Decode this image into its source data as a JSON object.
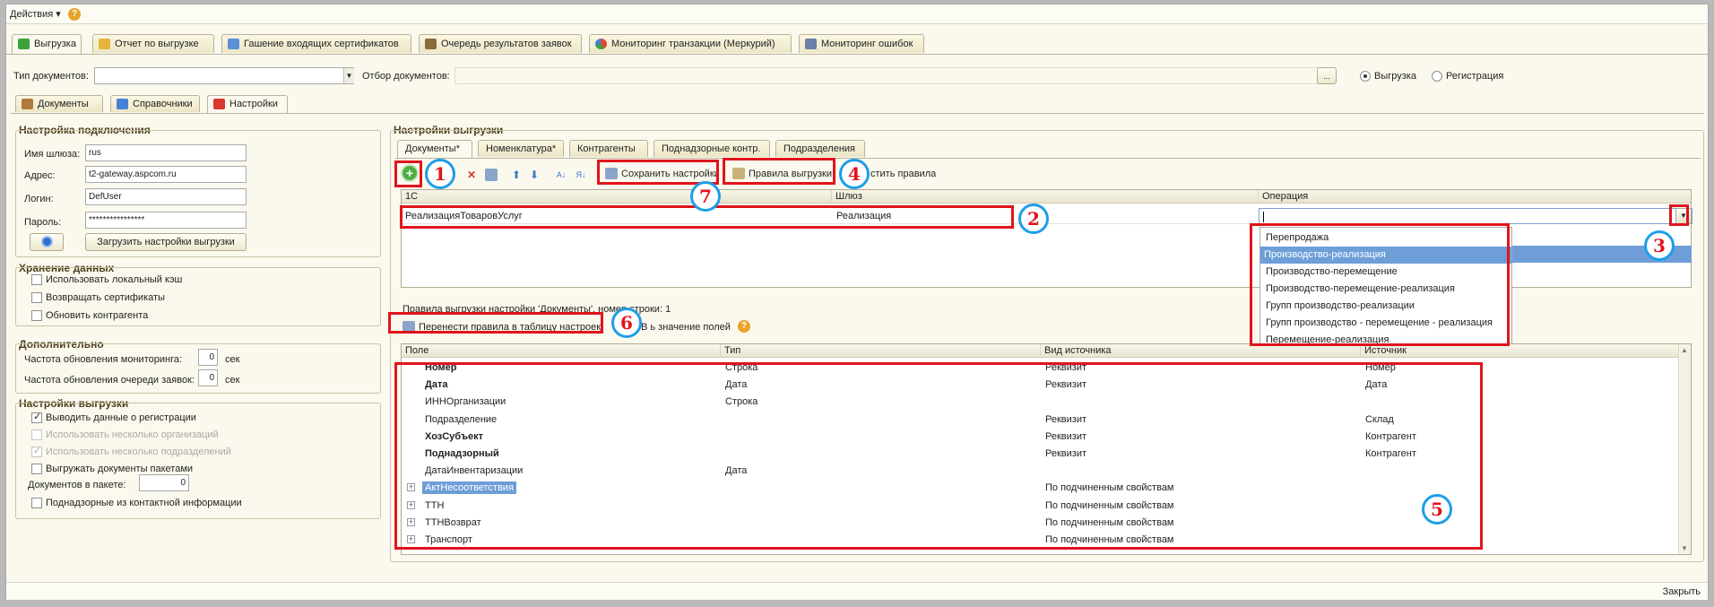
{
  "menu": {
    "actions": "Действия ▾",
    "help": "?"
  },
  "top_tabs": [
    {
      "label": "Выгрузка",
      "active": true,
      "icon": "export-icon",
      "color": "#3aa33a"
    },
    {
      "label": "Отчет по выгрузке",
      "icon": "report-icon",
      "color": "#e4b43c"
    },
    {
      "label": "Гашение входящих сертификатов",
      "icon": "certificate-icon",
      "color": "#5b8fd6"
    },
    {
      "label": "Очередь результатов заявок",
      "icon": "queue-icon",
      "color": "#8a6b3a"
    },
    {
      "label": "Мониторинг транзакции (Меркурий)",
      "icon": "pie-chart-icon",
      "color": "#e04a2a"
    },
    {
      "label": "Мониторинг ошибок",
      "icon": "monitor-icon",
      "color": "#6b7fa8"
    }
  ],
  "filter": {
    "doc_type_label": "Тип документов:",
    "doc_type_value": "",
    "selection_label": "Отбор документов:",
    "selection_value": "",
    "ellipsis": "...",
    "radio_export": "Выгрузка",
    "radio_register": "Регистрация"
  },
  "sub_tabs": [
    {
      "label": "Документы",
      "icon": "documents-icon"
    },
    {
      "label": "Справочники",
      "icon": "catalogs-icon"
    },
    {
      "label": "Настройки",
      "icon": "settings-icon",
      "active": true
    }
  ],
  "connection": {
    "title": "Настройка подключения",
    "gateway_label": "Имя шлюза:",
    "gateway_value": "rus",
    "address_label": "Адрес:",
    "address_value": "t2-gateway.aspcom.ru",
    "login_label": "Логин:",
    "login_value": "DefUser",
    "password_label": "Пароль:",
    "password_value": "****************",
    "load_button": "Загрузить настройки выгрузки"
  },
  "storage": {
    "title": "Хранение данных",
    "items": [
      {
        "label": "Использовать локальный кэш",
        "checked": false
      },
      {
        "label": "Возвращать сертификаты",
        "checked": false
      },
      {
        "label": "Обновить контрагента",
        "checked": false
      }
    ]
  },
  "additional": {
    "title": "Дополнительно",
    "monitoring_label": "Частота обновления мониторинга:",
    "monitoring_value": "0",
    "queue_label": "Частота обновления очереди заявок:",
    "queue_value": "0",
    "unit": "сек"
  },
  "export_settings_left": {
    "title": "Настройки выгрузки",
    "items": [
      {
        "label": "Выводить данные о регистрации",
        "checked": true,
        "disabled": false
      },
      {
        "label": "Использовать несколько организаций",
        "checked": false,
        "disabled": true
      },
      {
        "label": "Использовать несколько подразделений",
        "checked": true,
        "disabled": true
      },
      {
        "label": "Выгружать документы пакетами",
        "checked": false,
        "disabled": false
      }
    ],
    "batch_label": "Документов в пакете:",
    "batch_value": "0",
    "contact_label": "Поднадзорные из контактной информации"
  },
  "export_settings_right": {
    "title": "Настройки выгрузки",
    "tabs": [
      "Документы*",
      "Номенклатура*",
      "Контрагенты",
      "Поднадзорные контр.",
      "Подразделения"
    ],
    "toolbar": {
      "save_settings": "Сохранить настройки",
      "export_rules": "Правила выгрузки",
      "clear_rules": "стить правила"
    },
    "grid_headers": [
      "1С",
      "Шлюз",
      "Операция"
    ],
    "row": {
      "c1": "РеализацияТоваровУслуг",
      "c2": "Реализация",
      "c3": ""
    },
    "dropdown": [
      "Перепродажа",
      "Производство-реализация",
      "Производство-перемещение",
      "Производство-перемещение-реализация",
      "Групп производство-реализации",
      "Групп производство - перемещение - реализация",
      "Перемещение-реализация"
    ],
    "dropdown_selected": 1,
    "rules_caption": "Правила выгрузки настройки 'Документы', номер строки: 1",
    "transfer_button": "Перенести правила в таблицу настроек",
    "fields_link": "В      ь значение полей",
    "fields_headers": [
      "Поле",
      "Тип",
      "Вид источника",
      "Источник"
    ],
    "fields": [
      {
        "field": "Номер",
        "bold": true,
        "type": "Строка",
        "kind": "Реквизит",
        "source": "Номер"
      },
      {
        "field": "Дата",
        "bold": true,
        "type": "Дата",
        "kind": "Реквизит",
        "source": "Дата"
      },
      {
        "field": "ИННОрганизации",
        "bold": false,
        "type": "Строка",
        "kind": "",
        "source": ""
      },
      {
        "field": "Подразделение",
        "bold": false,
        "type": "",
        "kind": "Реквизит",
        "source": "Склад"
      },
      {
        "field": "ХозСубъект",
        "bold": true,
        "type": "",
        "kind": "Реквизит",
        "source": "Контрагент"
      },
      {
        "field": "Поднадзорный",
        "bold": true,
        "type": "",
        "kind": "Реквизит",
        "source": "Контрагент"
      },
      {
        "field": "ДатаИнвентаризации",
        "bold": false,
        "type": "Дата",
        "kind": "",
        "source": ""
      },
      {
        "field": "АктНесоответствия",
        "bold": false,
        "expand": true,
        "selected": true,
        "type": "",
        "kind": "По подчиненным свойствам",
        "source": ""
      },
      {
        "field": "ТТН",
        "bold": false,
        "expand": true,
        "type": "",
        "kind": "По подчиненным свойствам",
        "source": ""
      },
      {
        "field": "ТТНВозврат",
        "bold": false,
        "expand": true,
        "type": "",
        "kind": "По подчиненным свойствам",
        "source": ""
      },
      {
        "field": "Транспорт",
        "bold": false,
        "expand": true,
        "type": "",
        "kind": "По подчиненным свойствам",
        "source": ""
      }
    ]
  },
  "annotations": [
    "1",
    "2",
    "3",
    "4",
    "5",
    "6",
    "7"
  ],
  "status": {
    "close": "Закрыть"
  },
  "colors": {
    "annotation_red": "#e0141c",
    "annotation_blue": "#1e9ee6",
    "selection": "#6d9ed8"
  }
}
